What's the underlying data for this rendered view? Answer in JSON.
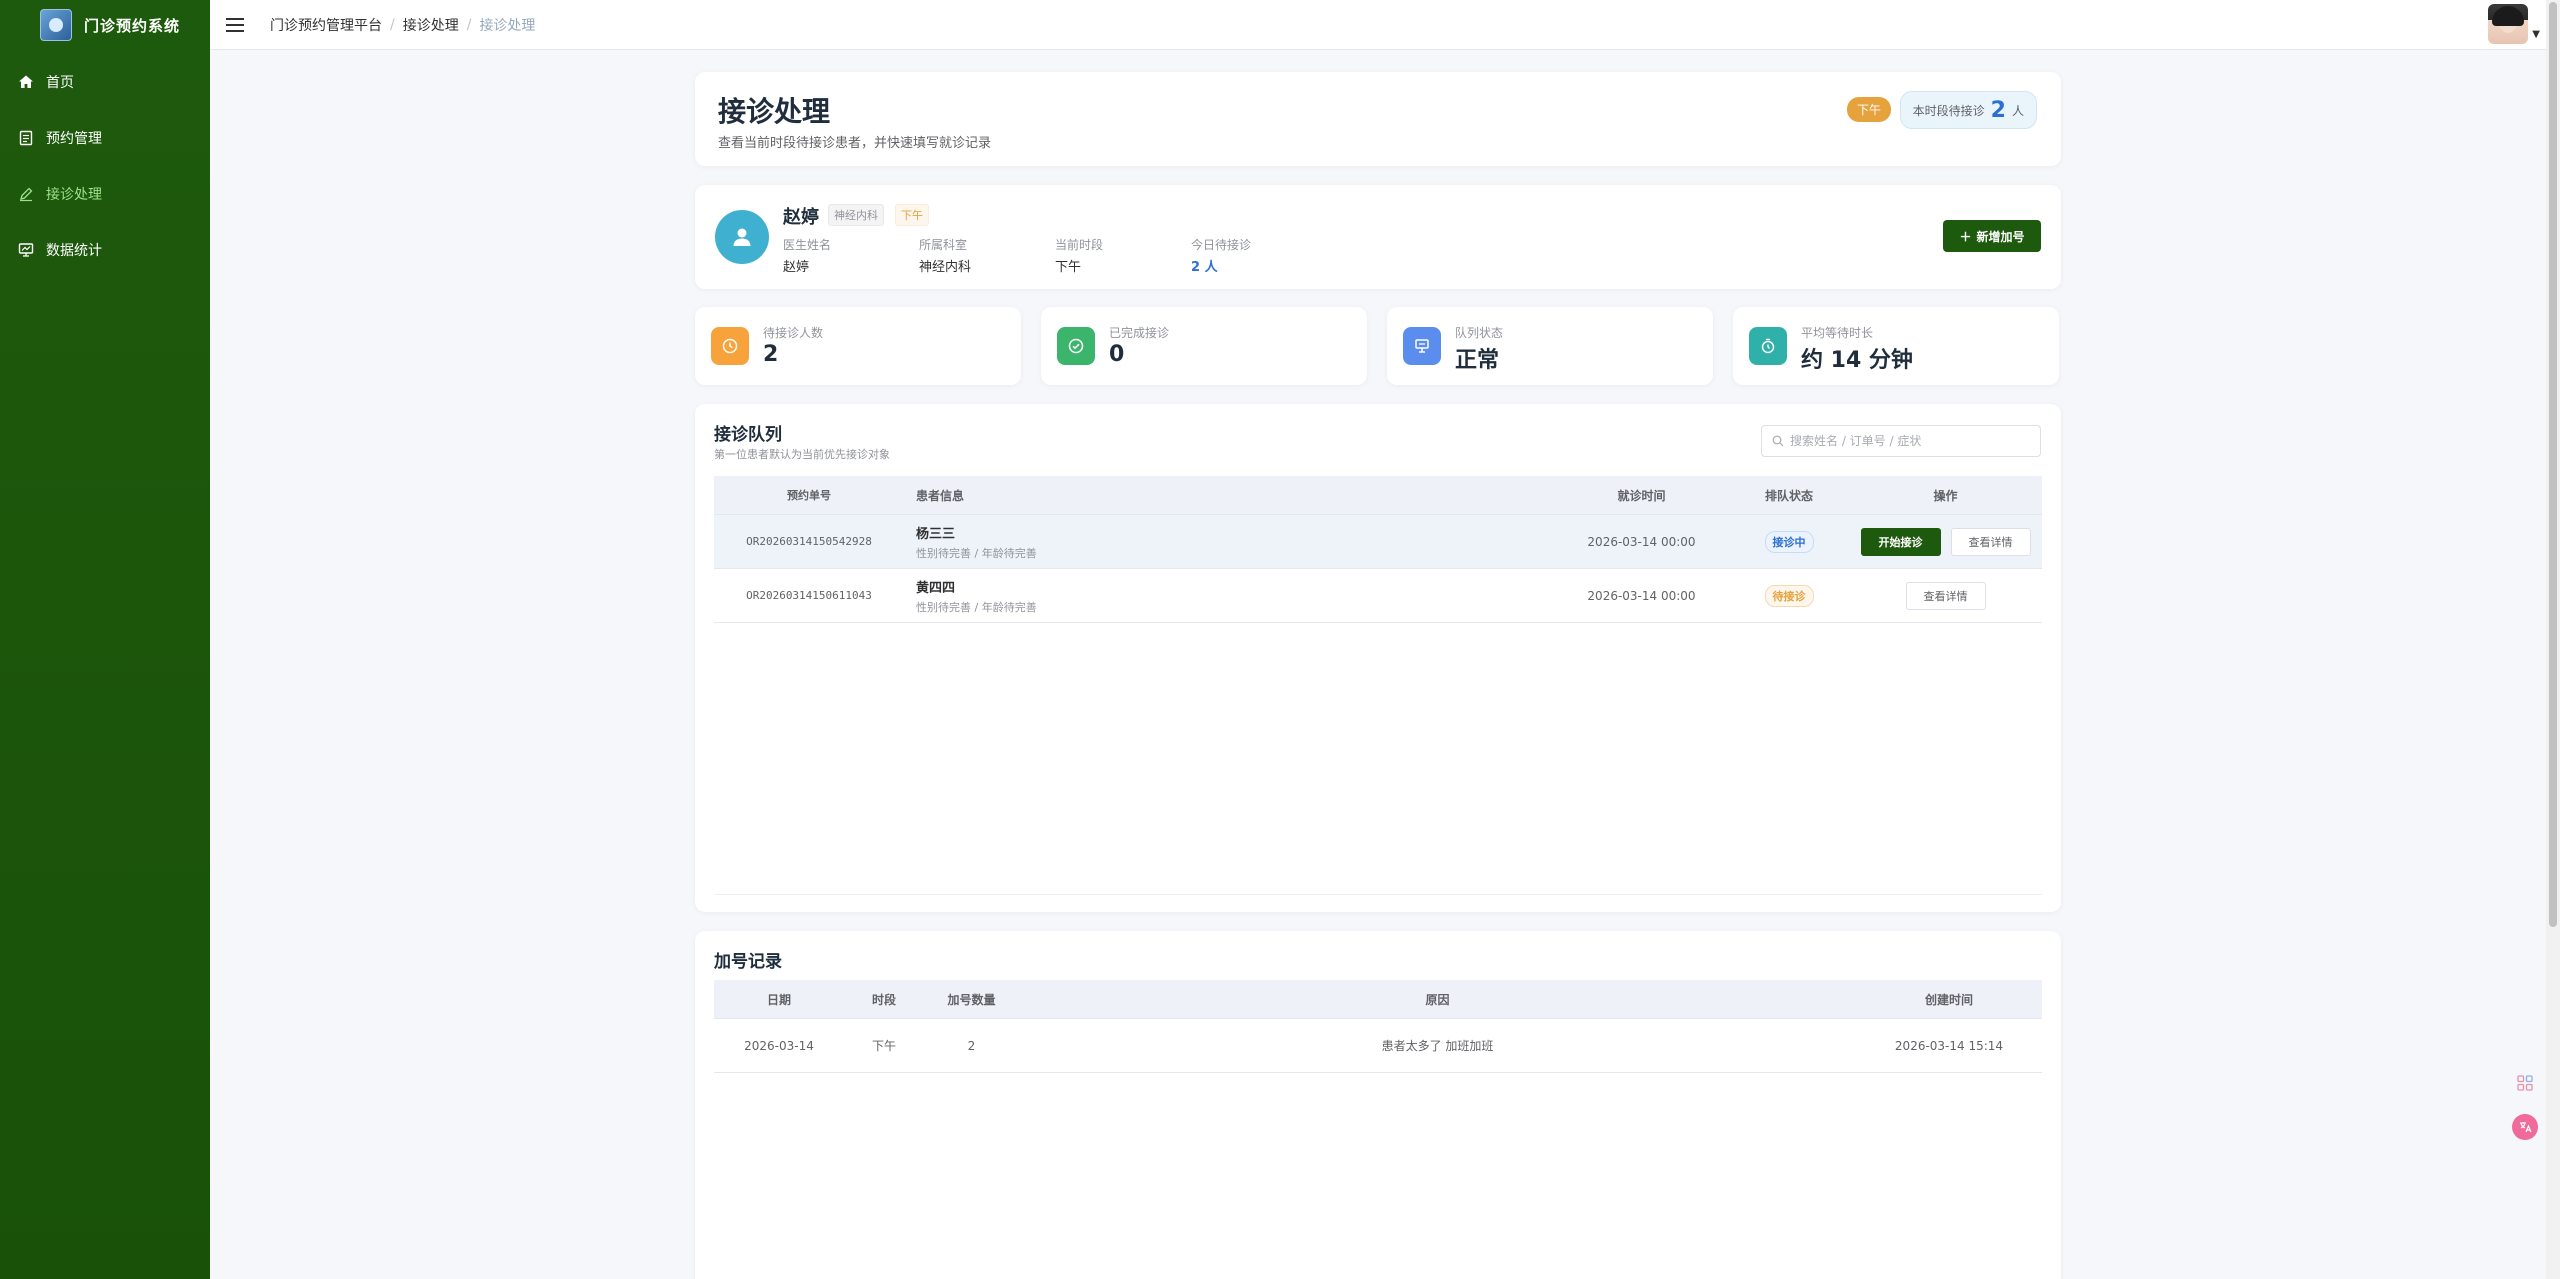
{
  "sidebar": {
    "brand": "门诊预约系统",
    "items": [
      {
        "label": "首页",
        "icon": "home-icon"
      },
      {
        "label": "预约管理",
        "icon": "document-icon"
      },
      {
        "label": "接诊处理",
        "icon": "edit-icon",
        "active": true
      },
      {
        "label": "数据统计",
        "icon": "chart-icon"
      }
    ]
  },
  "header": {
    "breadcrumb": [
      "门诊预约管理平台",
      "接诊处理",
      "接诊处理"
    ]
  },
  "title_card": {
    "title": "接诊处理",
    "subtitle": "查看当前时段待接诊患者，并快速填写就诊记录",
    "period_badge": "下午",
    "waiting_label": "本时段待接诊",
    "waiting_count": "2",
    "waiting_unit": "人"
  },
  "doctor": {
    "name": "赵婷",
    "dept_tag": "神经内科",
    "period_tag": "下午",
    "fields": [
      {
        "label": "医生姓名",
        "value": "赵婷"
      },
      {
        "label": "所属科室",
        "value": "神经内科"
      },
      {
        "label": "当前时段",
        "value": "下午"
      },
      {
        "label": "今日待接诊",
        "value": "2 人"
      }
    ],
    "add_button": "新增加号"
  },
  "stats": [
    {
      "label": "待接诊人数",
      "value": "2",
      "icon": "clock-icon",
      "color": "#f7a23b"
    },
    {
      "label": "已完成接诊",
      "value": "0",
      "icon": "check-circle-icon",
      "color": "#3bb56b"
    },
    {
      "label": "队列状态",
      "value": "正常",
      "icon": "queue-icon",
      "color": "#5b8def"
    },
    {
      "label": "平均等待时长",
      "value": "约 14 分钟",
      "icon": "timer-icon",
      "color": "#2fb0a8"
    }
  ],
  "queue": {
    "title": "接诊队列",
    "subtitle": "第一位患者默认为当前优先接诊对象",
    "search_placeholder": "搜索姓名 / 订单号 / 症状",
    "columns": [
      "预约单号",
      "患者信息",
      "就诊时间",
      "排队状态",
      "操作"
    ],
    "rows": [
      {
        "order": "OR20260314150542928",
        "name": "杨三三",
        "info": "性别待完善 / 年龄待完善",
        "time": "2026-03-14 00:00",
        "status": "接诊中",
        "start_label": "开始接诊",
        "detail_label": "查看详情"
      },
      {
        "order": "OR20260314150611043",
        "name": "黄四四",
        "info": "性别待完善 / 年龄待完善",
        "time": "2026-03-14 00:00",
        "status": "待接诊",
        "detail_label": "查看详情"
      }
    ]
  },
  "records": {
    "title": "加号记录",
    "columns": [
      "日期",
      "时段",
      "加号数量",
      "原因",
      "创建时间"
    ],
    "rows": [
      {
        "date": "2026-03-14",
        "period": "下午",
        "count": "2",
        "reason": "患者太多了 加班加班",
        "created": "2026-03-14 15:14"
      }
    ]
  },
  "colors": {
    "sidebar_bg": "#1e5a0d",
    "primary_button": "#1e5a0d",
    "active_nav": "#9fe28a",
    "accent_blue": "#2a6fd4",
    "warning": "#e6a23c"
  }
}
